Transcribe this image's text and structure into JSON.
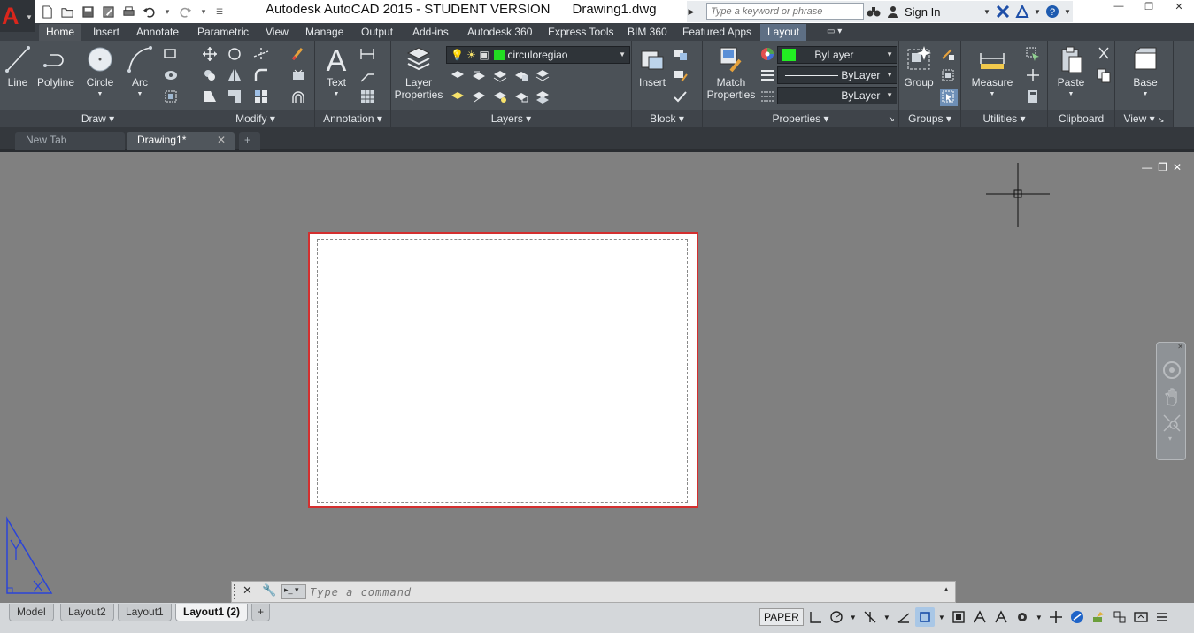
{
  "app": {
    "title": "Autodesk AutoCAD 2015 - STUDENT VERSION      Drawing1.dwg",
    "logo_letter": "A"
  },
  "search": {
    "placeholder": "Type a keyword or phrase"
  },
  "account": {
    "sign_in": "Sign In"
  },
  "colors": {
    "accent": "#d9261c",
    "bylayer_swatch": "#22ee22",
    "layer_swatch": "#22dd22",
    "paper_border": "#d42f2f",
    "ucs": "#2a44d8"
  },
  "ribbon": {
    "tabs": [
      "Home",
      "Insert",
      "Annotate",
      "Parametric",
      "View",
      "Manage",
      "Output",
      "Add-ins",
      "Autodesk 360",
      "Express Tools",
      "BIM 360",
      "Featured Apps",
      "Layout"
    ],
    "active_tab": "Home",
    "draw": {
      "line": "Line",
      "polyline": "Polyline",
      "circle": "Circle",
      "arc": "Arc",
      "label": "Draw"
    },
    "modify": {
      "label": "Modify"
    },
    "annotation": {
      "text": "Text",
      "label": "Annotation"
    },
    "layers": {
      "layer_properties_1": "Layer",
      "layer_properties_2": "Properties",
      "current_layer": "circuloregiao",
      "label": "Layers"
    },
    "block": {
      "insert": "Insert",
      "label": "Block"
    },
    "properties": {
      "match_1": "Match",
      "match_2": "Properties",
      "color": "ByLayer",
      "linetype": "ByLayer",
      "lineweight": "ByLayer",
      "label": "Properties"
    },
    "groups": {
      "group": "Group",
      "label": "Groups"
    },
    "utilities": {
      "measure": "Measure",
      "label": "Utilities"
    },
    "clipboard": {
      "paste": "Paste",
      "label": "Clipboard"
    },
    "view": {
      "base": "Base",
      "label": "View"
    }
  },
  "doc_tabs": [
    "New Tab",
    "Drawing1*"
  ],
  "command": {
    "placeholder": "Type a command"
  },
  "layout_tabs": [
    "Model",
    "Layout2",
    "Layout1",
    "Layout1 (2)"
  ],
  "active_layout": "Layout1 (2)",
  "status": {
    "space": "PAPER"
  }
}
